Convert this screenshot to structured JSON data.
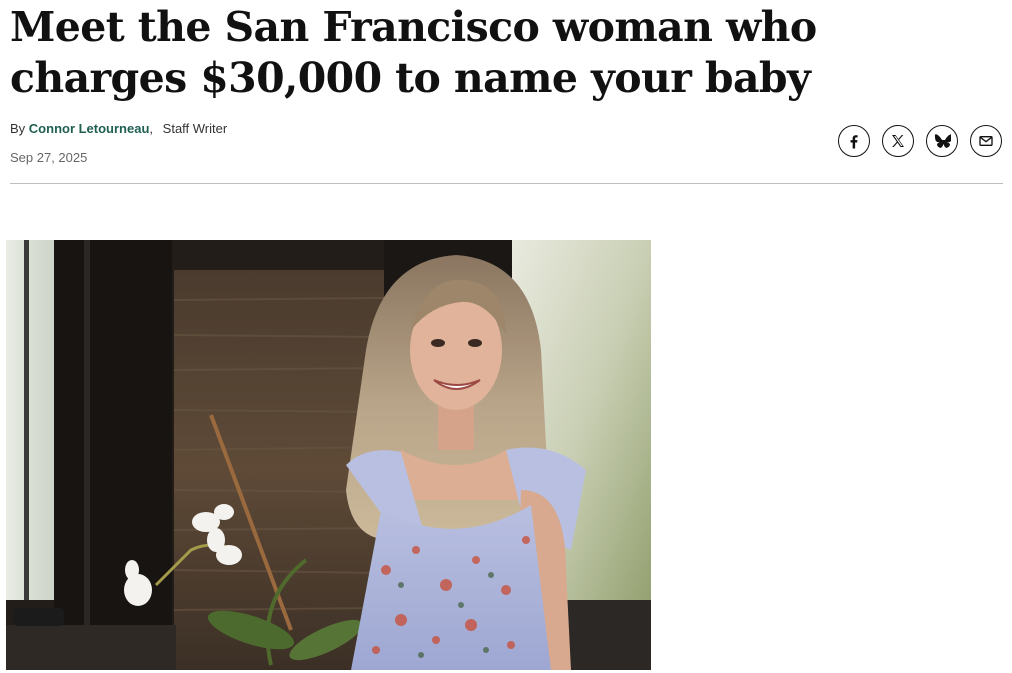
{
  "article": {
    "headline": "Meet the San Francisco woman who charges $30,000 to name your baby",
    "byline": {
      "prefix": "By",
      "author": "Connor Letourneau",
      "separator": ",",
      "role": "Staff Writer"
    },
    "date": "Sep 27, 2025"
  },
  "share": {
    "buttons": [
      {
        "icon": "facebook-icon"
      },
      {
        "icon": "x-twitter-icon"
      },
      {
        "icon": "bluesky-butterfly-icon"
      },
      {
        "icon": "email-envelope-icon"
      }
    ]
  },
  "colors": {
    "author_link": "#1f5f52",
    "rule": "#bdbdbd",
    "date_text": "#666666"
  },
  "hero_image": {
    "icon": "photo-woman-smiling-floral-dress"
  }
}
